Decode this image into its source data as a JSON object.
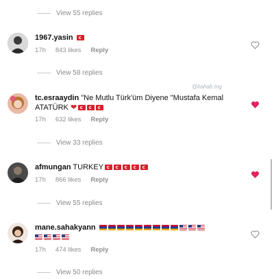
{
  "replies": [
    {
      "label": "View 55 replies"
    },
    {
      "label": "View 58 replies"
    },
    {
      "label": "View 33 replies"
    },
    {
      "label": "View 55 replies"
    },
    {
      "label": "View 50 replies"
    }
  ],
  "comments": [
    {
      "username": "1967.yasin",
      "text": "",
      "time": "17h",
      "likes": "843 likes",
      "reply": "Reply",
      "liked": false
    },
    {
      "username": "tc.esraaydin",
      "text": "\"Ne Mutlu Türk'üm Diyene \"Mustafa Kemal ATATÜRK",
      "time": "17h",
      "likes": "632 likes",
      "reply": "Reply",
      "liked": true
    },
    {
      "username": "afmungan",
      "text": "TURKEY",
      "time": "17h",
      "likes": "866 likes",
      "reply": "Reply",
      "liked": true
    },
    {
      "username": "mane.sahakyann",
      "text": "",
      "time": "17h",
      "likes": "474 likes",
      "reply": "Reply",
      "liked": false
    }
  ],
  "watermark": "@bahab.tng",
  "colors": {
    "heart_liked": "#e0245e",
    "heart_outline": "#8e8e8e",
    "meta": "#8f8f8f"
  }
}
